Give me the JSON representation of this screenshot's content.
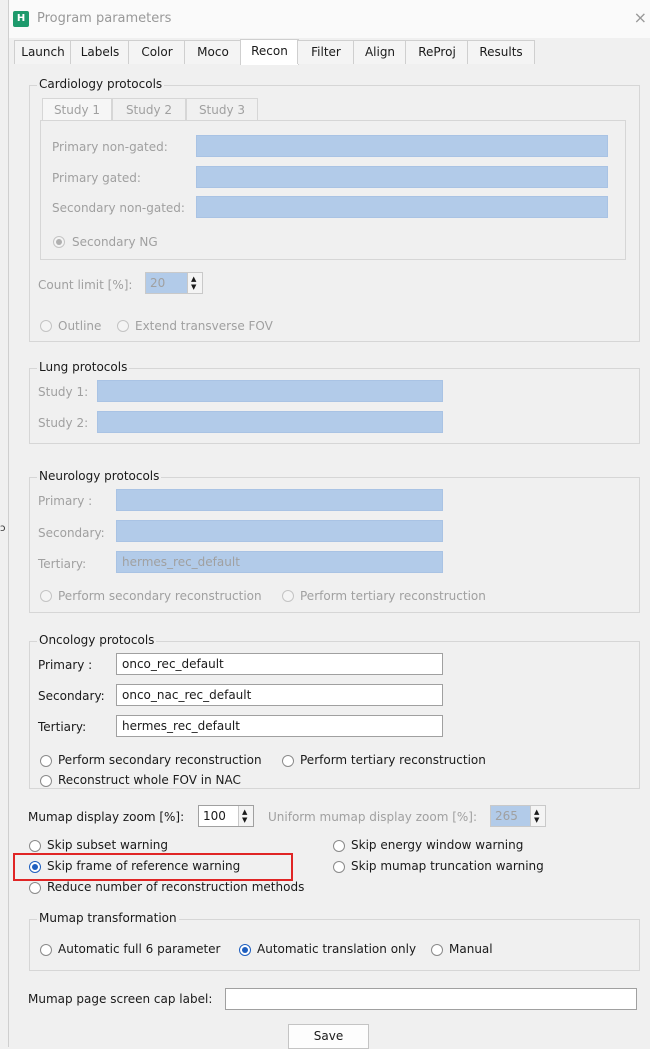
{
  "window": {
    "title": "Program parameters",
    "app_icon_letter": "H",
    "close_glyph": "×"
  },
  "tabs": [
    "Launch",
    "Labels",
    "Color",
    "Moco",
    "Recon",
    "Filter",
    "Align",
    "ReProj",
    "Results"
  ],
  "active_tab": "Recon",
  "cardiology": {
    "title": "Cardiology protocols",
    "subtabs": [
      "Study 1",
      "Study 2",
      "Study 3"
    ],
    "primary_nongated_label": "Primary non-gated:",
    "primary_gated_label": "Primary gated:",
    "secondary_nongated_label": "Secondary non-gated:",
    "secondary_ng_radio": "Secondary NG",
    "count_limit_label": "Count limit [%]:",
    "count_limit_value": "20",
    "outline_label": "Outline",
    "extend_fov_label": "Extend transverse FOV"
  },
  "lung": {
    "title": "Lung protocols",
    "study1_label": "Study 1:",
    "study2_label": "Study 2:"
  },
  "neurology": {
    "title": "Neurology protocols",
    "primary_label": "Primary :",
    "secondary_label": "Secondary:",
    "tertiary_label": "Tertiary:",
    "tertiary_value": "hermes_rec_default",
    "perform_secondary": "Perform secondary reconstruction",
    "perform_tertiary": "Perform tertiary reconstruction"
  },
  "oncology": {
    "title": "Oncology protocols",
    "primary_label": "Primary :",
    "primary_value": "onco_rec_default",
    "secondary_label": "Secondary:",
    "secondary_value": "onco_nac_rec_default",
    "tertiary_label": "Tertiary:",
    "tertiary_value": "hermes_rec_default",
    "perform_secondary": "Perform secondary reconstruction",
    "perform_tertiary": "Perform tertiary reconstruction",
    "reconstruct_whole": "Reconstruct whole FOV in NAC"
  },
  "mumap": {
    "zoom_label": "Mumap display zoom [%]:",
    "zoom_value": "100",
    "uniform_label": "Uniform mumap display zoom [%]:",
    "uniform_value": "265"
  },
  "warnings": {
    "skip_subset": "Skip subset warning",
    "skip_energy": "Skip energy window warning",
    "skip_frame": "Skip frame of reference warning",
    "skip_mumap_trunc": "Skip mumap truncation warning",
    "reduce_methods": "Reduce number of reconstruction methods"
  },
  "transformation": {
    "title": "Mumap transformation",
    "auto_full": "Automatic full 6 parameter",
    "auto_translation": "Automatic translation only",
    "manual": "Manual"
  },
  "cap_label": "Mumap page screen cap label:",
  "save_label": "Save",
  "colors": {
    "field_blue": "#b2cbe9",
    "radio_blue": "#1f5fbf",
    "highlight_red": "#e02525"
  }
}
